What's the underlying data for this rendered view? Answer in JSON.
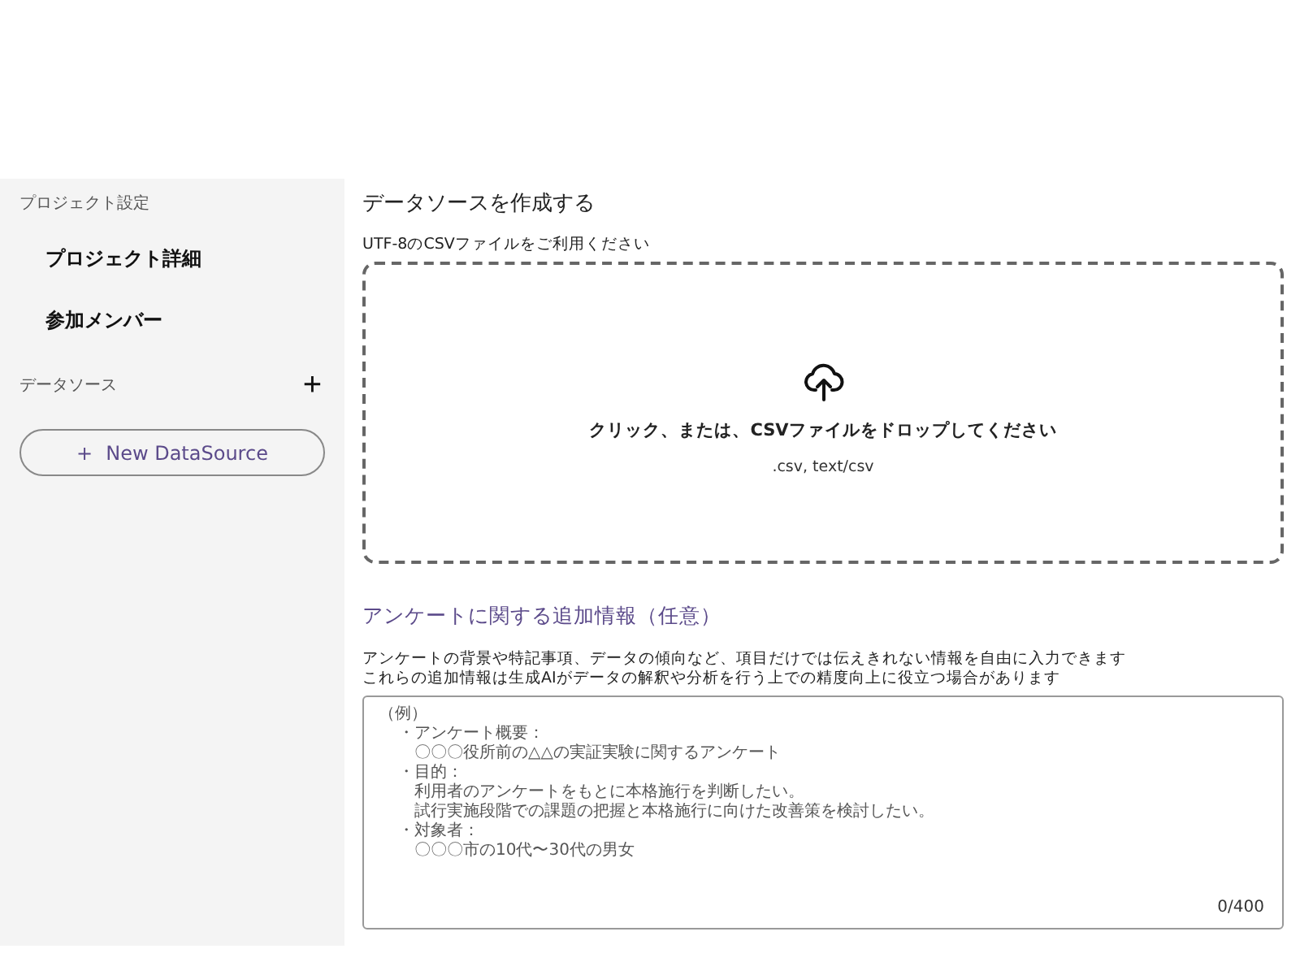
{
  "sidebar": {
    "sections": [
      {
        "heading": "プロジェクト設定",
        "items": [
          {
            "label": "プロジェクト詳細"
          },
          {
            "label": "参加メンバー"
          }
        ]
      },
      {
        "heading": "データソース",
        "add_icon": "+"
      }
    ],
    "new_button": {
      "icon": "+",
      "label": "New DataSource"
    }
  },
  "main": {
    "title": "データソースを作成する",
    "upload_hint": "UTF-8のCSVファイルをご利用ください",
    "dropzone": {
      "text": "クリック、または、CSVファイルをドロップしてください",
      "accept": ".csv, text/csv"
    },
    "info_title": "アンケートに関する追加情報（任意）",
    "info_lines": [
      "アンケートの背景や特記事項、データの傾向など、項目だけでは伝えきれない情報を自由に入力できます",
      "これらの追加情報は生成AIがデータの解釈や分析を行う上での精度向上に役立つ場合があります"
    ],
    "textarea": {
      "placeholder": [
        {
          "text": "（例）",
          "children": [
            {
              "text": "・アンケート概要：",
              "children": [
                {
                  "text": "〇〇〇役所前の△△の実証実験に関するアンケート"
                }
              ]
            },
            {
              "text": "・目的：",
              "children": [
                {
                  "text": "利用者のアンケートをもとに本格施行を判断したい。"
                },
                {
                  "text": "試行実施段階での課題の把握と本格施行に向けた改善策を検討したい。"
                }
              ]
            },
            {
              "text": "・対象者：",
              "children": [
                {
                  "text": "〇〇〇市の10代〜30代の男女"
                }
              ]
            }
          ]
        }
      ],
      "counter": "0/400"
    }
  }
}
